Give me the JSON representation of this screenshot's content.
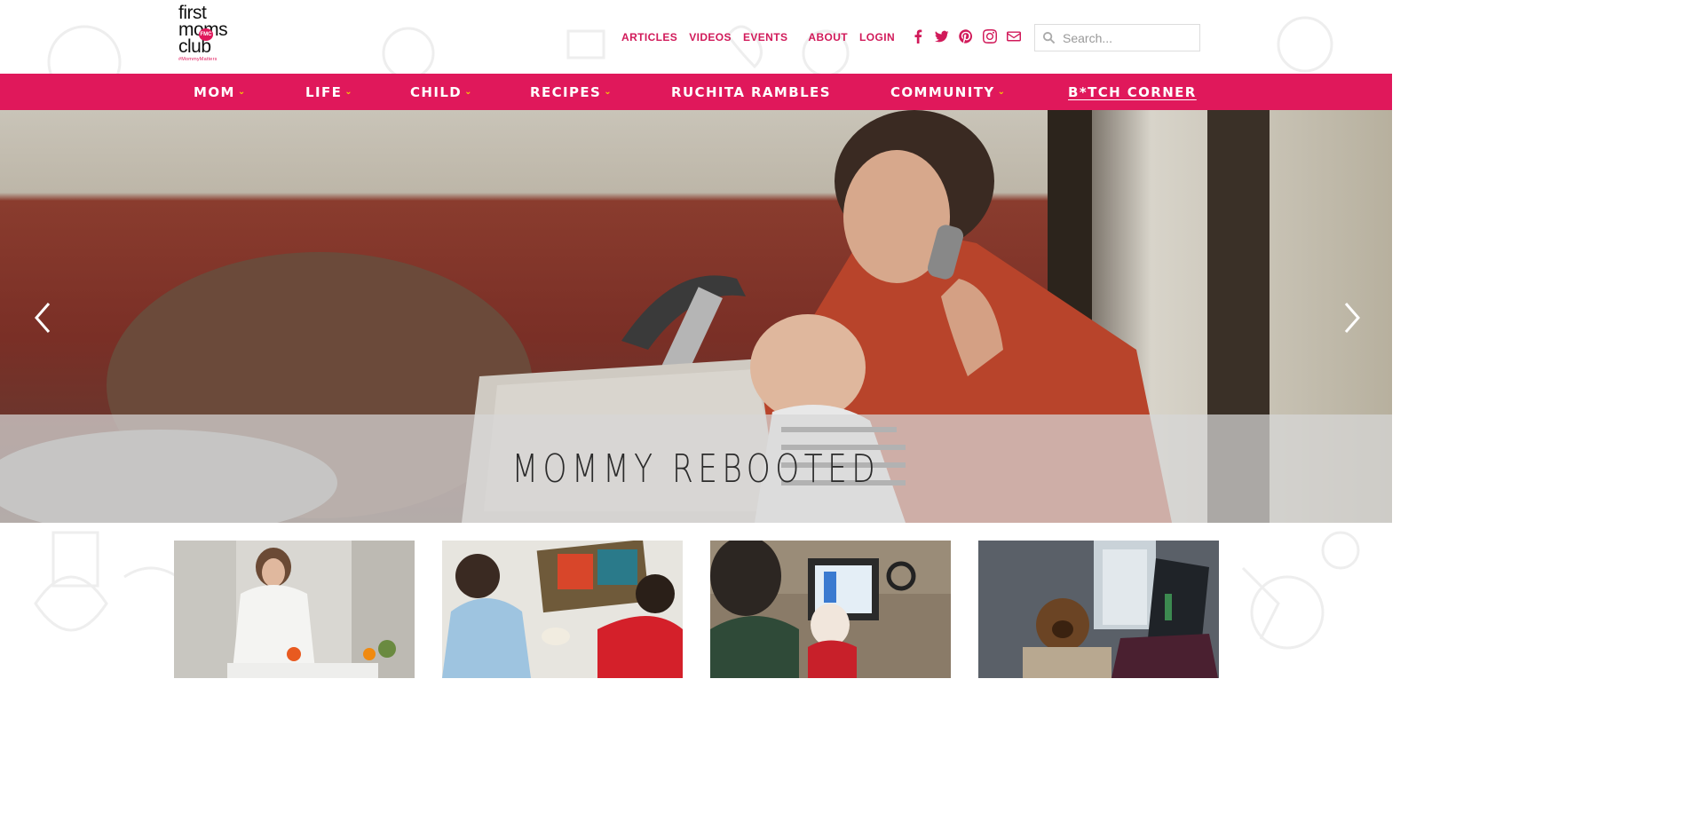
{
  "brand": {
    "logo_line1": "first",
    "logo_line2": "moms",
    "logo_line3": "club",
    "logo_badge": "FMC",
    "logo_tag": "#MommyMatters"
  },
  "topnav": {
    "articles": "ARTICLES",
    "videos": "VIDEOS",
    "events": "EVENTS",
    "about": "ABOUT",
    "login": "LOGIN"
  },
  "social": [
    "facebook-icon",
    "twitter-icon",
    "pinterest-icon",
    "instagram-icon",
    "mail-icon"
  ],
  "search": {
    "placeholder": "Search..."
  },
  "mainnav": {
    "items": [
      {
        "label": "MOM",
        "dropdown": true
      },
      {
        "label": "LIFE",
        "dropdown": true
      },
      {
        "label": "CHILD",
        "dropdown": true
      },
      {
        "label": "RECIPES",
        "dropdown": true
      },
      {
        "label": "RUCHITA RAMBLES",
        "dropdown": false
      },
      {
        "label": "COMMUNITY",
        "dropdown": true
      },
      {
        "label": "B*TCH CORNER",
        "dropdown": false
      }
    ],
    "chevron": "⌄"
  },
  "hero": {
    "caption": "MOMMY REBOOTED",
    "prev_icon": "chevron-left-icon",
    "next_icon": "chevron-right-icon"
  },
  "colors": {
    "brand": "#e0185b",
    "accent": "#f5d300",
    "nav_text": "#ffffff"
  },
  "cards": [
    {
      "image": "woman-cutting-vegetables-kitchen"
    },
    {
      "image": "kids-painting-on-floor"
    },
    {
      "image": "mother-baby-at-computer"
    },
    {
      "image": "teddy-bear-laptop-desk"
    }
  ]
}
